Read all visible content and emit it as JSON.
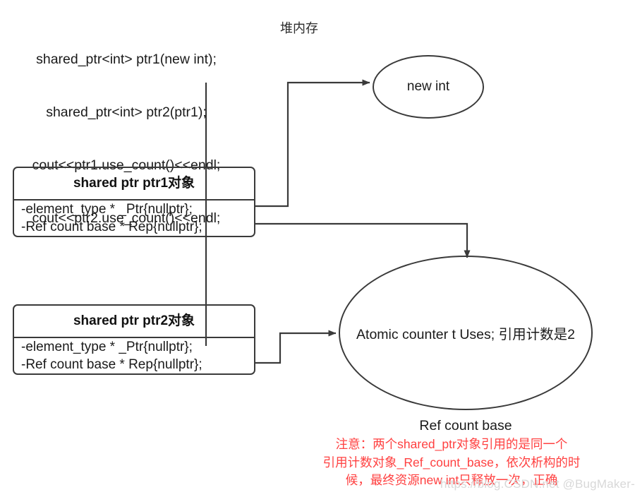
{
  "code": {
    "lines": [
      "shared_ptr<int> ptr1(new int);",
      "shared_ptr<int> ptr2(ptr1);",
      "cout<<ptr1.use_count()<<endl;",
      "cout<<ptr2.use_count()<<endl;"
    ]
  },
  "labels": {
    "heap": "堆内存",
    "refcount_caption": "Ref count base"
  },
  "nodes": {
    "new_int": {
      "text": "new int"
    },
    "ref_count": {
      "text": "Atomic counter t  Uses;  引用计数是2"
    }
  },
  "boxes": [
    {
      "title": "shared ptr ptr1对象",
      "field_ptr": "-element_type * _Ptr{nullptr};",
      "field_rep": "-Ref count base *  Rep{nullptr};"
    },
    {
      "title": "shared ptr ptr2对象",
      "field_ptr": "-element_type * _Ptr{nullptr};",
      "field_rep": "-Ref count base *  Rep{nullptr};"
    }
  ],
  "note": {
    "color": "#ff4040",
    "lines": [
      "注意：两个shared_ptr对象引用的是同一个",
      "引用计数对象_Ref_count_base，依次析构的时",
      "候，最终资源new int只释放一次，正确"
    ]
  },
  "watermark": {
    "text": "https://blog.CSDN.net @BugMaker-shen"
  },
  "style": {
    "stroke": "#3a3a3a",
    "text": "#1a1a1a",
    "background": "#ffffff"
  }
}
